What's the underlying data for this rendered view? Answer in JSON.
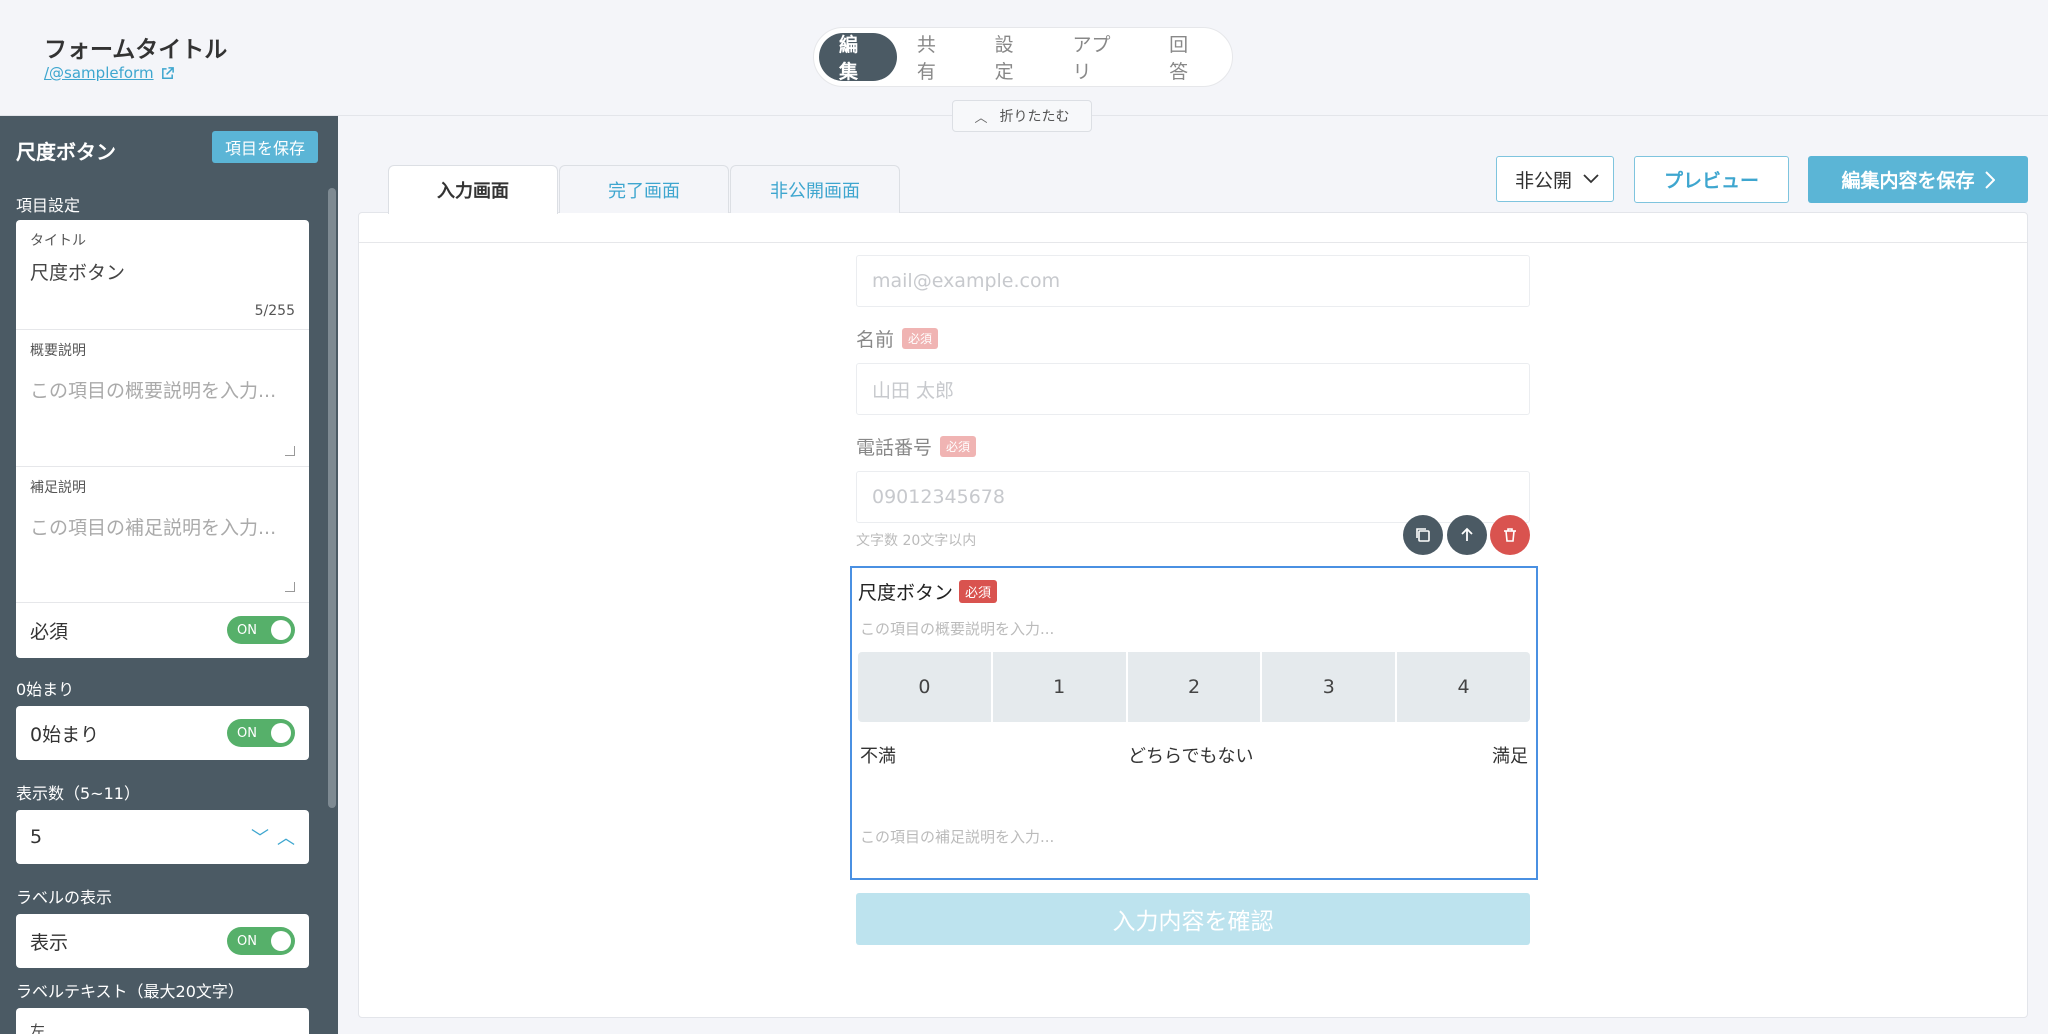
{
  "header": {
    "form_title": "フォームタイトル",
    "form_link": "/@sampleform",
    "nav": [
      "編集",
      "共有",
      "設定",
      "アプリ",
      "回答"
    ],
    "collapse": "折りたたむ"
  },
  "sidebar": {
    "title": "尺度ボタン",
    "save_label": "項目を保存",
    "section_item_settings": "項目設定",
    "title_field": {
      "label": "タイトル",
      "value": "尺度ボタン",
      "count": "5/255"
    },
    "summary_field": {
      "label": "概要説明",
      "placeholder": "この項目の概要説明を入力..."
    },
    "supplement_field": {
      "label": "補足説明",
      "placeholder": "この項目の補足説明を入力..."
    },
    "required": {
      "label": "必須",
      "toggle": "ON"
    },
    "zero_start_section": "0始まり",
    "zero_start": {
      "label": "0始まり",
      "toggle": "ON"
    },
    "count_section": "表示数（5~11）",
    "count_value": "5",
    "label_display_section": "ラベルの表示",
    "label_display": {
      "label": "表示",
      "toggle": "ON"
    },
    "label_text_section": "ラベルテキスト（最大20文字）",
    "label_text_first": "左"
  },
  "tabs": [
    "入力画面",
    "完了画面",
    "非公開画面"
  ],
  "toolbar": {
    "status": "非公開",
    "preview": "プレビュー",
    "save": "編集内容を保存"
  },
  "form": {
    "email_placeholder": "mail@example.com",
    "name_label": "名前",
    "name_placeholder": "山田 太郎",
    "phone_label": "電話番号",
    "phone_placeholder": "09012345678",
    "phone_hint": "文字数 20文字以内",
    "required_badge": "必須",
    "scale": {
      "title": "尺度ボタン",
      "description_placeholder": "この項目の概要説明を入力...",
      "options": [
        "0",
        "1",
        "2",
        "3",
        "4"
      ],
      "label_left": "不満",
      "label_center": "どちらでもない",
      "label_right": "満足",
      "supplement_placeholder": "この項目の補足説明を入力..."
    },
    "confirm": "入力内容を確認"
  },
  "colors": {
    "sidebar_bg": "#4b5a64",
    "accent": "#5bb5d6",
    "toggle_on": "#56b06a",
    "danger": "#d9534f",
    "selection": "#4a90e2"
  }
}
